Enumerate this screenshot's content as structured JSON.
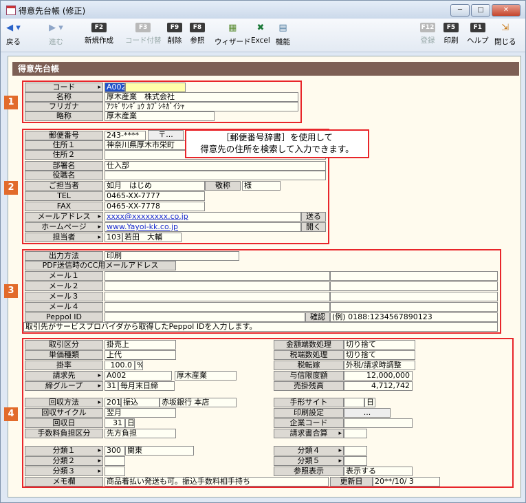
{
  "window": {
    "title": "得意先台帳 (修正)",
    "min": "─",
    "max": "□",
    "close": "✕"
  },
  "toolbar": {
    "back": "戻る",
    "forward": "進む",
    "new": {
      "key": "F2",
      "label": "新規作成"
    },
    "code": {
      "key": "F3",
      "label": "コード付替"
    },
    "delete": {
      "key": "F9",
      "label": "削除"
    },
    "ref": {
      "key": "F8",
      "label": "参照"
    },
    "wizard": "ウィザード",
    "excel": "Excel",
    "func": "機能",
    "register": {
      "key": "F12",
      "label": "登録"
    },
    "print": {
      "key": "F5",
      "label": "印刷"
    },
    "help": {
      "key": "F1",
      "label": "ヘルプ"
    },
    "closebtn": "閉じる"
  },
  "section_title": "得意先台帳",
  "badges": [
    "1",
    "2",
    "3",
    "4"
  ],
  "s1": {
    "code_label": "コード",
    "code": "A002",
    "name_label": "名称",
    "name": "厚木産業　株式会社",
    "kana_label": "フリガナ",
    "kana": "ｱﾂｷﾞｻﾝｷﾞｮｳ ｶﾌﾞｼｷｶﾞｲｼｬ",
    "short_label": "略称",
    "short": "厚木産業"
  },
  "s2": {
    "zip_label": "郵便番号",
    "zip": "243-****",
    "zip_btn": "〒...",
    "addr1_label": "住所１",
    "addr1": "神奈川県厚木市栄町",
    "addr2_label": "住所２",
    "addr2": "",
    "dept_label": "部署名",
    "dept": "仕入部",
    "post_label": "役職名",
    "post": "",
    "person_label": "ご担当者",
    "person": "如月　はじめ",
    "honor_label": "敬称",
    "honor": "様",
    "tel_label": "TEL",
    "tel": "0465-XX-7777",
    "fax_label": "FAX",
    "fax": "0465-XX-7778",
    "mail_label": "メールアドレス",
    "mail": "xxxx@xxxxxxxx.co.jp",
    "send": "送る",
    "hp_label": "ホームページ",
    "hp": "www.Yayoi-kk.co.jp",
    "open": "開く",
    "staff_label": "担当者",
    "staff_code": "103",
    "staff": "若田　大輔"
  },
  "tip": {
    "line1": "［郵便番号辞書］を使用して",
    "line2": "得意先の住所を検索して入力できます。"
  },
  "s3": {
    "output_label": "出力方法",
    "output": "印刷",
    "cc_label": "PDF送信時のCC用メールアドレス",
    "mail1": "メール１",
    "mail2": "メール２",
    "mail3": "メール３",
    "mail4": "メール４",
    "peppol_label": "Peppol ID",
    "confirm": "確認",
    "example": "(例) 0188:1234567890123",
    "note": "取引先がサービスプロバイダから取得したPeppol IDを入力します。"
  },
  "s4": {
    "trade_label": "取引区分",
    "trade": "掛売上",
    "price_label": "単価種類",
    "price": "上代",
    "rate_label": "掛率",
    "rate": "100.0",
    "pct": "%",
    "bill_label": "請求先",
    "bill_code": "A002",
    "bill_name": "厚木産業",
    "close_label": "締グループ",
    "close_code": "31",
    "close": "毎月末日締",
    "round_label": "金額端数処理",
    "round": "切り捨て",
    "taxround_label": "税端数処理",
    "taxround": "切り捨て",
    "taxconv_label": "税転嫁",
    "taxconv": "外税/請求時調整",
    "credit_label": "与信限度額",
    "credit": "12,000,000",
    "balance_label": "売掛残高",
    "balance": "4,712,742",
    "collect_label": "回収方法",
    "collect_code": "201",
    "collect": "振込",
    "bank": "赤坂銀行 本店",
    "cycle_label": "回収サイクル",
    "cycle": "翌月",
    "day_label": "回収日",
    "day": "31",
    "day_unit": "日",
    "fee_label": "手数料負担区分",
    "fee": "先方負担",
    "note_label": "手形サイト",
    "note_unit": "日",
    "print_label": "印刷設定",
    "print": "...",
    "corp_label": "企業コード",
    "merge_label": "請求書合算",
    "c1_label": "分類１",
    "c1_code": "300",
    "c1": "関東",
    "c2_label": "分類２",
    "c3_label": "分類３",
    "c4_label": "分類４",
    "c5_label": "分類５",
    "disp_label": "参照表示",
    "disp": "表示する",
    "memo_label": "メモ欄",
    "memo": "商品着払い発送も可。振込手数料相手持ち",
    "upd_label": "更新日",
    "upd": "20**/10/ 3"
  }
}
